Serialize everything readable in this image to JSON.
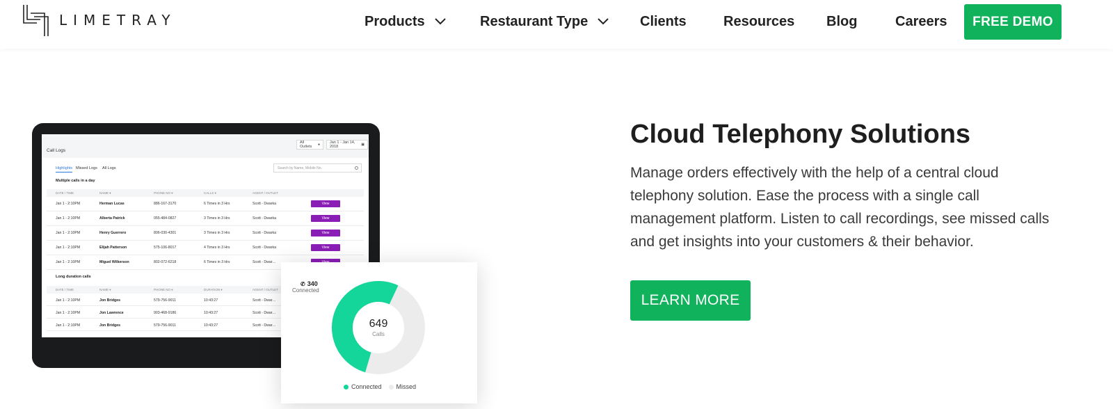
{
  "brand": {
    "name": "LIMETRAY",
    "accent": "#10b25c"
  },
  "nav": {
    "items": [
      {
        "label": "Products",
        "dropdown": true
      },
      {
        "label": "Restaurant Type",
        "dropdown": true
      },
      {
        "label": "Clients",
        "dropdown": false
      },
      {
        "label": "Resources",
        "dropdown": false
      },
      {
        "label": "Blog",
        "dropdown": false
      },
      {
        "label": "Careers",
        "dropdown": false
      }
    ],
    "cta_label": "FREE DEMO"
  },
  "hero": {
    "title": "Cloud Telephony Solutions",
    "description": "Manage orders effectively with the help of a central cloud telephony solution. Ease the process with a single call management platform. Listen to call recordings, see missed calls and get insights into your customers & their behavior.",
    "cta_label": "LEARN MORE"
  },
  "mockup": {
    "outlet_filter": "All Outlets",
    "date_filter": "Jan 1 - Jan 14, 2018",
    "page_title": "Call Logs",
    "tabs": [
      "Highlights",
      "Missed Logs",
      "All Logs"
    ],
    "search_placeholder": "Search by Name, Mobile No.",
    "section1": {
      "title": "Multiple calls in a day",
      "headers": [
        "DATE / TIME",
        "NAME ▾",
        "PHONE NO ▾",
        "CALLS ▾",
        "AGENT / OUTLET"
      ],
      "rows": [
        {
          "date": "Jan 1 - 2:10PM",
          "name": "Herman Lucas",
          "phone": "886-167-3170",
          "calls": "6 Times in 3 Hrs",
          "agent": "Scott - Dwarka",
          "action": "View"
        },
        {
          "date": "Jan 1 - 2:10PM",
          "name": "Alberta Patrick",
          "phone": "055-484-0827",
          "calls": "3 Times in 3 Hrs",
          "agent": "Scott - Dwarka",
          "action": "View"
        },
        {
          "date": "Jan 1 - 2:10PM",
          "name": "Henry Guerrero",
          "phone": "806-030-4301",
          "calls": "3 Times in 3 Hrs",
          "agent": "Scott - Dwarka",
          "action": "View"
        },
        {
          "date": "Jan 1 - 2:10PM",
          "name": "Elijah Patterson",
          "phone": "575-106-8017",
          "calls": "4 Times in 3 Hrs",
          "agent": "Scott - Dwarka",
          "action": "View"
        },
        {
          "date": "Jan 1 - 2:10PM",
          "name": "Miguel Wilkerson",
          "phone": "802-072-6218",
          "calls": "6 Times in 3 Hrs",
          "agent": "Scott - Dwar…",
          "action": "View"
        }
      ]
    },
    "section2": {
      "title": "Long duration calls",
      "headers": [
        "DATE / TIME",
        "NAME ▾",
        "PHONE NO ▾",
        "DURATION ▾",
        "AGENT / OUTLET"
      ],
      "rows": [
        {
          "date": "Jan 1 - 2:10PM",
          "name": "Jon Bridges",
          "phone": "579-756-9011",
          "duration": "10:43:27",
          "agent": "Scott - Dwar…"
        },
        {
          "date": "Jan 1 - 2:10PM",
          "name": "Jon Lawrence",
          "phone": "903-468-9186",
          "duration": "10:43:27",
          "agent": "Scott - Dwar…"
        },
        {
          "date": "Jan 1 - 2:10PM",
          "name": "Jon Bridges",
          "phone": "579-756-9011",
          "duration": "10:43:27",
          "agent": "Scott - Dwar…"
        }
      ]
    },
    "donut": {
      "total": "649",
      "total_label": "Calls",
      "connected_value": 340,
      "connected_text": "340",
      "connected_label": "Connected",
      "legend": [
        {
          "label": "Connected",
          "color": "#14d69a"
        },
        {
          "label": "Missed",
          "color": "#ececec"
        }
      ]
    }
  }
}
